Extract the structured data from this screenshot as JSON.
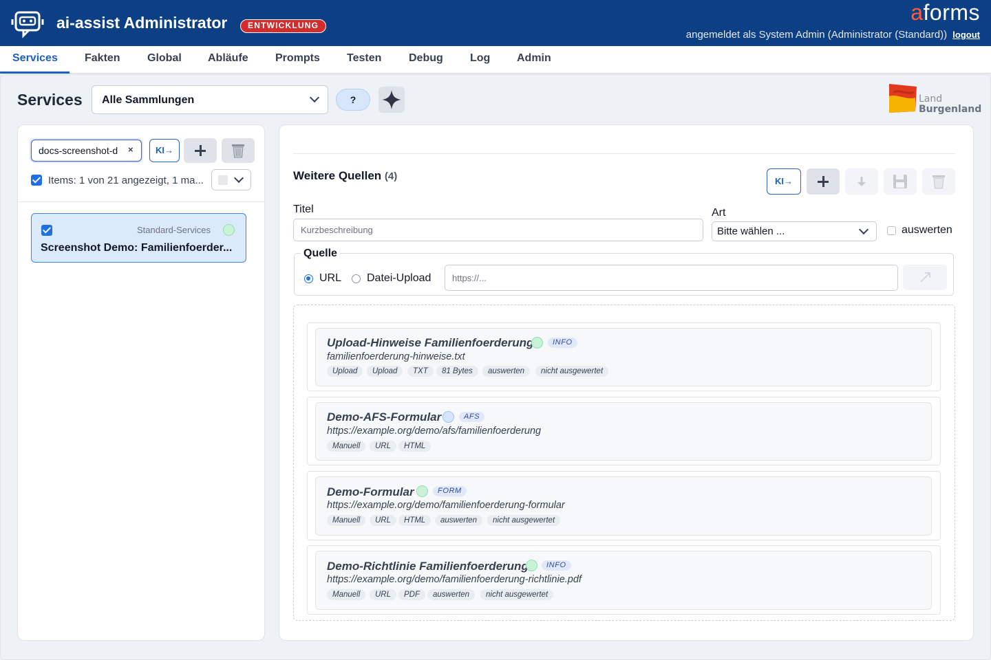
{
  "header": {
    "app_title": "ai-assist Administrator",
    "env_badge": "ENTWICKLUNG",
    "brand_a": "a",
    "brand_rest": "forms",
    "user_text": "angemeldet als System Admin (Administrator (Standard))",
    "logout": "logout"
  },
  "nav": {
    "tabs": [
      {
        "label": "Services",
        "active": true
      },
      {
        "label": "Fakten"
      },
      {
        "label": "Global"
      },
      {
        "label": "Abläufe"
      },
      {
        "label": "Prompts"
      },
      {
        "label": "Testen"
      },
      {
        "label": "Debug"
      },
      {
        "label": "Log"
      },
      {
        "label": "Admin"
      }
    ]
  },
  "page": {
    "title": "Services",
    "collection_select": "Alle Sammlungen",
    "help_label": "?",
    "land_logo_line1": "Land",
    "land_logo_line2": "Burgenland"
  },
  "left": {
    "filter_value": "docs-screenshot-d",
    "clear_label": "×",
    "ki_label": "KI→",
    "items_text": "Items: 1 von 21 angezeigt, 1 ma...",
    "service": {
      "collection": "Standard-Services",
      "name": "Screenshot Demo: Familienfoerder..."
    }
  },
  "right": {
    "section_title": "Weitere Quellen",
    "section_count": "(4)",
    "ki_label": "KI→",
    "titel_label": "Titel",
    "titel_placeholder": "Kurzbeschreibung",
    "art_label": "Art",
    "art_value": "Bitte wählen ...",
    "auswerten_label": "auswerten",
    "quelle_legend": "Quelle",
    "radio_url": "URL",
    "radio_upload": "Datei-Upload",
    "url_placeholder": "https://...",
    "sources": [
      {
        "title": "Upload-Hinweise Familienfoerderung",
        "badge": "INFO",
        "status": "green",
        "sub": "familienfoerderung-hinweise.txt",
        "tags": [
          "Upload",
          "Upload",
          "TXT",
          "81 Bytes",
          "auswerten",
          "nicht ausgewertet"
        ]
      },
      {
        "title": "Demo-AFS-Formular",
        "badge": "AFS",
        "status": "blue",
        "sub": "https://example.org/demo/afs/familienfoerderung",
        "tags": [
          "Manuell",
          "URL",
          "HTML"
        ]
      },
      {
        "title": "Demo-Formular",
        "badge": "FORM",
        "status": "green",
        "sub": "https://example.org/demo/familienfoerderung-formular",
        "tags": [
          "Manuell",
          "URL",
          "HTML",
          "auswerten",
          "nicht ausgewertet"
        ]
      },
      {
        "title": "Demo-Richtlinie Familienfoerderung",
        "badge": "INFO",
        "status": "green",
        "sub": "https://example.org/demo/familienfoerderung-richtlinie.pdf",
        "tags": [
          "Manuell",
          "URL",
          "PDF",
          "auswerten",
          "nicht ausgewertet"
        ]
      }
    ]
  },
  "colors": {
    "header_bg": "#0d3f85",
    "accent": "#1d5fbf",
    "env_badge": "#d32c2c",
    "brand_a": "#ff5a3c"
  }
}
